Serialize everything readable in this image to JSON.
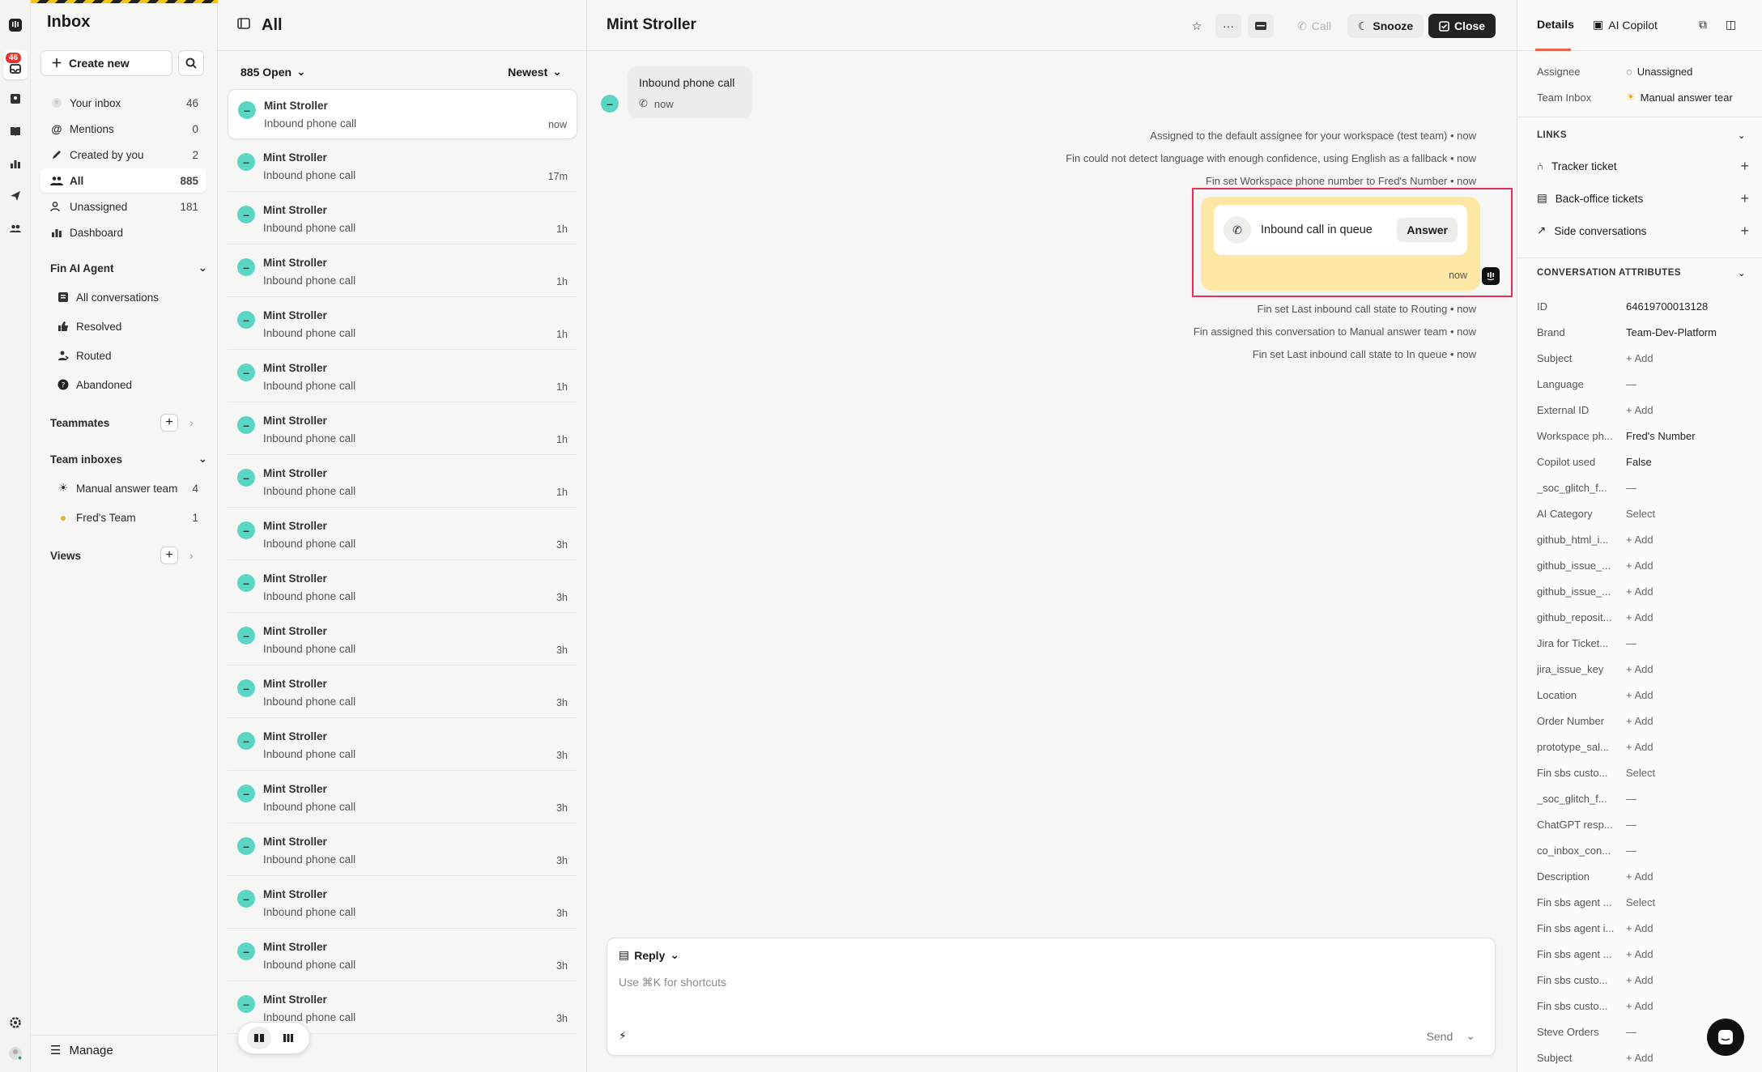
{
  "rail": {
    "badge": "46"
  },
  "nav": {
    "title": "Inbox",
    "create_new": "Create new",
    "items": [
      {
        "label": "Your inbox",
        "count": "46"
      },
      {
        "label": "Mentions",
        "count": "0"
      },
      {
        "label": "Created by you",
        "count": "2"
      },
      {
        "label": "All",
        "count": "885"
      },
      {
        "label": "Unassigned",
        "count": "181"
      },
      {
        "label": "Dashboard",
        "count": ""
      }
    ],
    "fin_section": "Fin AI Agent",
    "fin_items": [
      "All conversations",
      "Resolved",
      "Routed",
      "Abandoned"
    ],
    "teammates": "Teammates",
    "team_inboxes": "Team inboxes",
    "teams": [
      {
        "label": "Manual answer team",
        "count": "4"
      },
      {
        "label": "Fred's Team",
        "count": "1"
      }
    ],
    "views": "Views",
    "manage": "Manage"
  },
  "list": {
    "title": "All",
    "filter": "885 Open",
    "sort": "Newest",
    "conversations": [
      {
        "name": "Mint Stroller",
        "subject": "Inbound phone call",
        "time": "now"
      },
      {
        "name": "Mint Stroller",
        "subject": "Inbound phone call",
        "time": "17m"
      },
      {
        "name": "Mint Stroller",
        "subject": "Inbound phone call",
        "time": "1h"
      },
      {
        "name": "Mint Stroller",
        "subject": "Inbound phone call",
        "time": "1h"
      },
      {
        "name": "Mint Stroller",
        "subject": "Inbound phone call",
        "time": "1h"
      },
      {
        "name": "Mint Stroller",
        "subject": "Inbound phone call",
        "time": "1h"
      },
      {
        "name": "Mint Stroller",
        "subject": "Inbound phone call",
        "time": "1h"
      },
      {
        "name": "Mint Stroller",
        "subject": "Inbound phone call",
        "time": "1h"
      },
      {
        "name": "Mint Stroller",
        "subject": "Inbound phone call",
        "time": "3h"
      },
      {
        "name": "Mint Stroller",
        "subject": "Inbound phone call",
        "time": "3h"
      },
      {
        "name": "Mint Stroller",
        "subject": "Inbound phone call",
        "time": "3h"
      },
      {
        "name": "Mint Stroller",
        "subject": "Inbound phone call",
        "time": "3h"
      },
      {
        "name": "Mint Stroller",
        "subject": "Inbound phone call",
        "time": "3h"
      },
      {
        "name": "Mint Stroller",
        "subject": "Inbound phone call",
        "time": "3h"
      },
      {
        "name": "Mint Stroller",
        "subject": "Inbound phone call",
        "time": "3h"
      },
      {
        "name": "Mint Stroller",
        "subject": "Inbound phone call",
        "time": "3h"
      },
      {
        "name": "Mint Stroller",
        "subject": "Inbound phone call",
        "time": "3h"
      },
      {
        "name": "Mint Stroller",
        "subject": "Inbound phone call",
        "time": "3h"
      }
    ]
  },
  "conversation": {
    "title": "Mint Stroller",
    "actions": {
      "call": "Call",
      "snooze": "Snooze",
      "close": "Close"
    },
    "first_message": {
      "text": "Inbound phone call",
      "time": "now"
    },
    "events_top": [
      "Assigned to the default assignee for your workspace (test team) • now",
      "Fin could not detect language with enough confidence, using English as a fallback • now",
      "Fin set Workspace phone number to Fred's Number • now"
    ],
    "queue": {
      "label": "Inbound call in queue",
      "answer": "Answer",
      "time": "now"
    },
    "events_bottom": [
      "Fin set Last inbound call state to Routing • now",
      "Fin assigned this conversation to Manual answer team • now",
      "Fin set Last inbound call state to In queue • now"
    ],
    "composer": {
      "mode": "Reply",
      "placeholder": "Use ⌘K for shortcuts",
      "send": "Send"
    }
  },
  "details": {
    "tabs": {
      "details": "Details",
      "copilot": "AI Copilot"
    },
    "assignee_label": "Assignee",
    "assignee_value": "Unassigned",
    "team_label": "Team Inbox",
    "team_value": "Manual answer tear",
    "links_title": "LINKS",
    "links": [
      "Tracker ticket",
      "Back-office tickets",
      "Side conversations"
    ],
    "attrs_title": "CONVERSATION ATTRIBUTES",
    "attributes": [
      {
        "k": "ID",
        "v": "64619700013128"
      },
      {
        "k": "Brand",
        "v": "Team-Dev-Platform"
      },
      {
        "k": "Subject",
        "v": "+ Add"
      },
      {
        "k": "Language",
        "v": "—"
      },
      {
        "k": "External ID",
        "v": "+ Add"
      },
      {
        "k": "Workspace ph...",
        "v": "Fred's Number"
      },
      {
        "k": "Copilot used",
        "v": "False"
      },
      {
        "k": "_soc_glitch_f...",
        "v": "—"
      },
      {
        "k": "AI Category",
        "v": "Select"
      },
      {
        "k": "github_html_i...",
        "v": "+ Add"
      },
      {
        "k": "github_issue_...",
        "v": "+ Add"
      },
      {
        "k": "github_issue_...",
        "v": "+ Add"
      },
      {
        "k": "github_reposit...",
        "v": "+ Add"
      },
      {
        "k": "Jira for Ticket...",
        "v": "—"
      },
      {
        "k": "jira_issue_key",
        "v": "+ Add"
      },
      {
        "k": "Location",
        "v": "+ Add"
      },
      {
        "k": "Order Number",
        "v": "+ Add"
      },
      {
        "k": "prototype_sal...",
        "v": "+ Add"
      },
      {
        "k": "Fin sbs custo...",
        "v": "Select"
      },
      {
        "k": "_soc_glitch_f...",
        "v": "—"
      },
      {
        "k": "ChatGPT resp...",
        "v": "—"
      },
      {
        "k": "co_inbox_con...",
        "v": "—"
      },
      {
        "k": "Description",
        "v": "+ Add"
      },
      {
        "k": "Fin sbs agent ...",
        "v": "Select"
      },
      {
        "k": "Fin sbs agent i...",
        "v": "+ Add"
      },
      {
        "k": "Fin sbs agent ...",
        "v": "+ Add"
      },
      {
        "k": "Fin sbs custo...",
        "v": "+ Add"
      },
      {
        "k": "Fin sbs custo...",
        "v": "+ Add"
      },
      {
        "k": "Steve Orders",
        "v": "—"
      },
      {
        "k": "Subject",
        "v": "+ Add"
      }
    ]
  },
  "colors": {
    "accent_teal": "#5cd6c4",
    "queue_yellow": "#fce7a4",
    "highlight": "#e0325a",
    "tab_underline": "#e8664c"
  }
}
